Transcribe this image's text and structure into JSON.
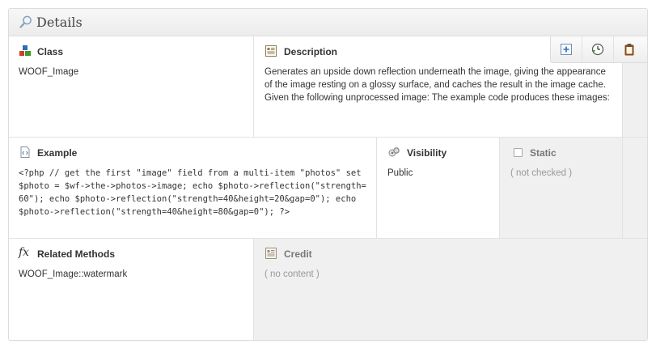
{
  "panel": {
    "title": "Details"
  },
  "fields": {
    "class": {
      "label": "Class",
      "value": "WOOF_Image"
    },
    "description": {
      "label": "Description",
      "value": "Generates an upside down reflection underneath the image, giving the appearance of the image resting on a glossy surface, and caches the result in the image cache. Given the following unprocessed image:     The example code produces these images:"
    },
    "example": {
      "label": "Example",
      "value": "<?php // get the first \"image\" field from a multi-item \"photos\" set $photo = $wf->the->photos->image; echo $photo->reflection(\"strength=60\"); echo $photo->reflection(\"strength=40&height=20&gap=0\"); echo $photo->reflection(\"strength=40&height=80&gap=0\"); ?>"
    },
    "visibility": {
      "label": "Visibility",
      "value": "Public"
    },
    "static": {
      "label": "Static",
      "value": "( not checked )"
    },
    "related_methods": {
      "label": "Related Methods",
      "value": "WOOF_Image::watermark"
    },
    "credit": {
      "label": "Credit",
      "value": "( no content )"
    }
  },
  "toolbar": {
    "buttons": [
      {
        "name": "add",
        "icon": "plus-icon"
      },
      {
        "name": "history",
        "icon": "clock-icon"
      },
      {
        "name": "clipboard",
        "icon": "clipboard-icon"
      }
    ]
  },
  "colors": {
    "accent_green": "#3a9a2a",
    "clipboard_brown": "#8a4b12",
    "plus_blue": "#2d6fb3"
  }
}
